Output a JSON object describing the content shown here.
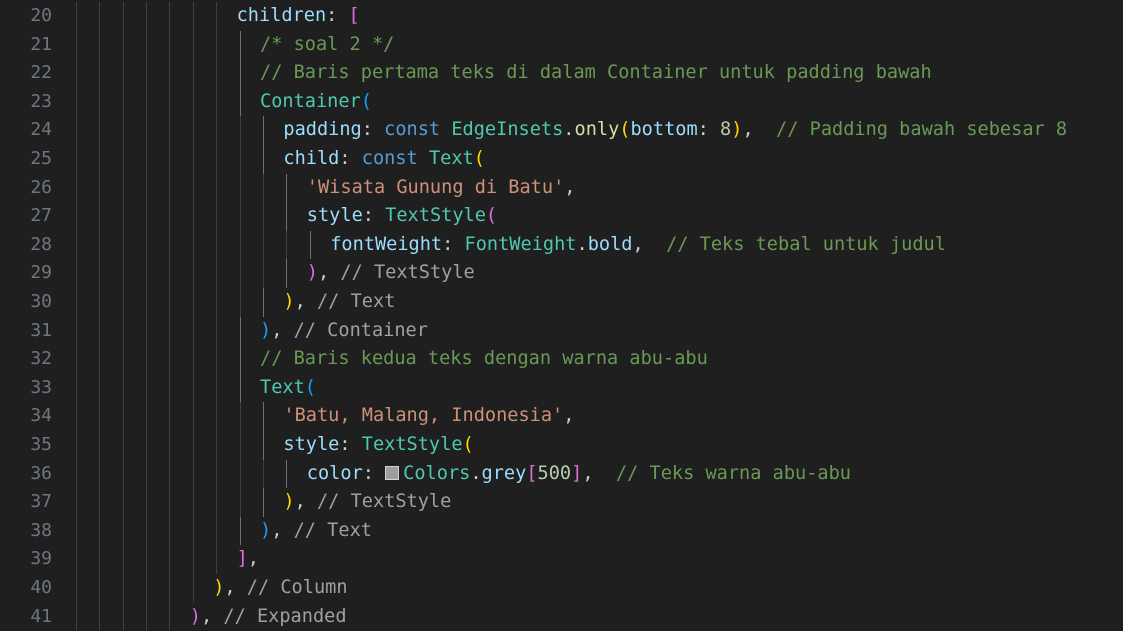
{
  "editor": {
    "colors": {
      "background": "#1f1f1f",
      "line_number": "#6e7681",
      "property": "#9cdcfe",
      "keyword": "#569cd6",
      "class": "#4ec9b0",
      "function": "#dcdcaa",
      "string": "#ce9178",
      "number": "#b5cea8",
      "comment": "#6a9955",
      "punctuation": "#cccccc",
      "bracket_gold": "#ffd700",
      "bracket_pink": "#da70d6",
      "bracket_blue": "#179fff"
    },
    "lines": [
      {
        "num": "20",
        "indent": 9,
        "tokens": [
          [
            "children",
            "#9cdcfe"
          ],
          [
            ": ",
            "#cccccc"
          ],
          [
            "[",
            "#da70d6"
          ]
        ]
      },
      {
        "num": "21",
        "indent": 10,
        "tokens": [
          [
            "/* soal 2 */",
            "#6a9955"
          ]
        ]
      },
      {
        "num": "22",
        "indent": 10,
        "tokens": [
          [
            "// Baris pertama teks di dalam Container untuk padding bawah",
            "#6a9955"
          ]
        ]
      },
      {
        "num": "23",
        "indent": 10,
        "tokens": [
          [
            "Container",
            "#4ec9b0"
          ],
          [
            "(",
            "#179fff"
          ]
        ]
      },
      {
        "num": "24",
        "indent": 11,
        "tokens": [
          [
            "padding",
            "#9cdcfe"
          ],
          [
            ": ",
            "#cccccc"
          ],
          [
            "const",
            "#569cd6"
          ],
          [
            " ",
            "#cccccc"
          ],
          [
            "EdgeInsets",
            "#4ec9b0"
          ],
          [
            ".",
            "#cccccc"
          ],
          [
            "only",
            "#dcdcaa"
          ],
          [
            "(",
            "#ffd700"
          ],
          [
            "bottom",
            "#9cdcfe"
          ],
          [
            ": ",
            "#cccccc"
          ],
          [
            "8",
            "#b5cea8"
          ],
          [
            ")",
            "#ffd700"
          ],
          [
            ",  ",
            "#cccccc"
          ],
          [
            "// Padding bawah sebesar 8",
            "#6a9955"
          ]
        ]
      },
      {
        "num": "25",
        "indent": 11,
        "tokens": [
          [
            "child",
            "#9cdcfe"
          ],
          [
            ": ",
            "#cccccc"
          ],
          [
            "const",
            "#569cd6"
          ],
          [
            " ",
            "#cccccc"
          ],
          [
            "Text",
            "#4ec9b0"
          ],
          [
            "(",
            "#ffd700"
          ]
        ]
      },
      {
        "num": "26",
        "indent": 12,
        "tokens": [
          [
            "'Wisata Gunung di Batu'",
            "#ce9178"
          ],
          [
            ",",
            "#cccccc"
          ]
        ]
      },
      {
        "num": "27",
        "indent": 12,
        "tokens": [
          [
            "style",
            "#9cdcfe"
          ],
          [
            ": ",
            "#cccccc"
          ],
          [
            "TextStyle",
            "#4ec9b0"
          ],
          [
            "(",
            "#da70d6"
          ]
        ]
      },
      {
        "num": "28",
        "indent": 13,
        "tokens": [
          [
            "fontWeight",
            "#9cdcfe"
          ],
          [
            ": ",
            "#cccccc"
          ],
          [
            "FontWeight",
            "#4ec9b0"
          ],
          [
            ".",
            "#cccccc"
          ],
          [
            "bold",
            "#9cdcfe"
          ],
          [
            ",  ",
            "#cccccc"
          ],
          [
            "// Teks tebal untuk judul",
            "#6a9955"
          ]
        ]
      },
      {
        "num": "29",
        "indent": 12,
        "tokens": [
          [
            ")",
            "#da70d6"
          ],
          [
            ", ",
            "#cccccc"
          ],
          [
            "// TextStyle",
            "#a0a0a0"
          ]
        ]
      },
      {
        "num": "30",
        "indent": 11,
        "tokens": [
          [
            ")",
            "#ffd700"
          ],
          [
            ", ",
            "#cccccc"
          ],
          [
            "// Text",
            "#a0a0a0"
          ]
        ]
      },
      {
        "num": "31",
        "indent": 10,
        "tokens": [
          [
            ")",
            "#179fff"
          ],
          [
            ", ",
            "#cccccc"
          ],
          [
            "// Container",
            "#a0a0a0"
          ]
        ]
      },
      {
        "num": "32",
        "indent": 10,
        "tokens": [
          [
            "// Baris kedua teks dengan warna abu-abu",
            "#6a9955"
          ]
        ]
      },
      {
        "num": "33",
        "indent": 10,
        "tokens": [
          [
            "Text",
            "#4ec9b0"
          ],
          [
            "(",
            "#179fff"
          ]
        ]
      },
      {
        "num": "34",
        "indent": 11,
        "tokens": [
          [
            "'Batu, Malang, Indonesia'",
            "#ce9178"
          ],
          [
            ",",
            "#cccccc"
          ]
        ]
      },
      {
        "num": "35",
        "indent": 11,
        "tokens": [
          [
            "style",
            "#9cdcfe"
          ],
          [
            ": ",
            "#cccccc"
          ],
          [
            "TextStyle",
            "#4ec9b0"
          ],
          [
            "(",
            "#ffd700"
          ]
        ]
      },
      {
        "num": "36",
        "indent": 12,
        "tokens": [
          [
            "color",
            "#9cdcfe"
          ],
          [
            ": ",
            "#cccccc"
          ],
          [
            "__swatch__",
            "#9e9e9e"
          ],
          [
            "Colors",
            "#4ec9b0"
          ],
          [
            ".",
            "#cccccc"
          ],
          [
            "grey",
            "#9cdcfe"
          ],
          [
            "[",
            "#da70d6"
          ],
          [
            "500",
            "#b5cea8"
          ],
          [
            "]",
            "#da70d6"
          ],
          [
            ",  ",
            "#cccccc"
          ],
          [
            "// Teks warna abu-abu",
            "#6a9955"
          ]
        ]
      },
      {
        "num": "37",
        "indent": 11,
        "tokens": [
          [
            ")",
            "#ffd700"
          ],
          [
            ", ",
            "#cccccc"
          ],
          [
            "// TextStyle",
            "#a0a0a0"
          ]
        ]
      },
      {
        "num": "38",
        "indent": 10,
        "tokens": [
          [
            ")",
            "#179fff"
          ],
          [
            ", ",
            "#cccccc"
          ],
          [
            "// Text",
            "#a0a0a0"
          ]
        ]
      },
      {
        "num": "39",
        "indent": 9,
        "tokens": [
          [
            "]",
            "#da70d6"
          ],
          [
            ",",
            "#cccccc"
          ]
        ]
      },
      {
        "num": "40",
        "indent": 8,
        "tokens": [
          [
            ")",
            "#ffd700"
          ],
          [
            ", ",
            "#cccccc"
          ],
          [
            "// Column",
            "#a0a0a0"
          ]
        ]
      },
      {
        "num": "41",
        "indent": 7,
        "tokens": [
          [
            ")",
            "#da70d6"
          ],
          [
            ", ",
            "#cccccc"
          ],
          [
            "// Expanded",
            "#a0a0a0"
          ]
        ]
      }
    ]
  }
}
